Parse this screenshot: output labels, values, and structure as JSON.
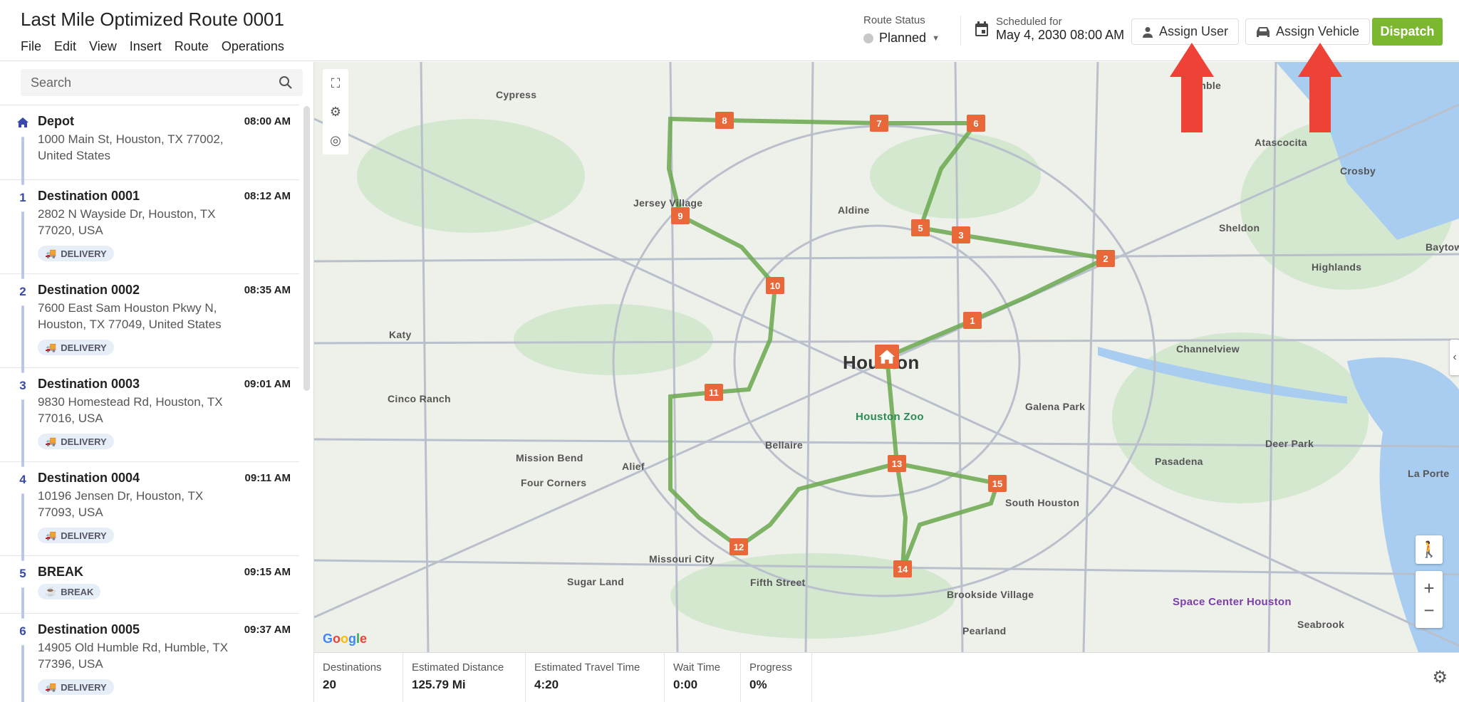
{
  "header": {
    "title": "Last Mile Optimized Route 0001",
    "menu": [
      "File",
      "Edit",
      "View",
      "Insert",
      "Route",
      "Operations"
    ],
    "route_status_label": "Route Status",
    "route_status_value": "Planned",
    "scheduled_label": "Scheduled for",
    "scheduled_value": "May 4, 2030 08:00 AM",
    "assign_user": "Assign User",
    "assign_vehicle": "Assign Vehicle",
    "dispatch": "Dispatch"
  },
  "sidebar": {
    "search_placeholder": "Search",
    "items": [
      {
        "num": "",
        "name": "Depot",
        "time": "08:00 AM",
        "address": "1000 Main St, Houston, TX 77002, United States",
        "badge": ""
      },
      {
        "num": "1",
        "name": "Destination 0001",
        "time": "08:12 AM",
        "address": "2802 N Wayside Dr, Houston, TX 77020, USA",
        "badge": "DELIVERY"
      },
      {
        "num": "2",
        "name": "Destination 0002",
        "time": "08:35 AM",
        "address": "7600 East Sam Houston Pkwy N, Houston, TX 77049, United States",
        "badge": "DELIVERY"
      },
      {
        "num": "3",
        "name": "Destination 0003",
        "time": "09:01 AM",
        "address": "9830 Homestead Rd, Houston, TX 77016, USA",
        "badge": "DELIVERY"
      },
      {
        "num": "4",
        "name": "Destination 0004",
        "time": "09:11 AM",
        "address": "10196 Jensen Dr, Houston, TX 77093, USA",
        "badge": "DELIVERY"
      },
      {
        "num": "5",
        "name": "BREAK",
        "time": "09:15 AM",
        "address": "",
        "badge": "BREAK"
      },
      {
        "num": "6",
        "name": "Destination 0005",
        "time": "09:37 AM",
        "address": "14905 Old Humble Rd, Humble, TX 77396, USA",
        "badge": "DELIVERY"
      }
    ]
  },
  "map": {
    "markers": [
      "1",
      "2",
      "3",
      "5",
      "6",
      "7",
      "8",
      "9",
      "10",
      "11",
      "12",
      "13",
      "14",
      "15"
    ],
    "labels": [
      "Houston",
      "Houston Zoo",
      "Space Center Houston",
      "Cypress",
      "Jersey Village",
      "Aldine",
      "Humble",
      "Sheldon",
      "Channelview",
      "Katy",
      "Cinco Ranch",
      "Bellaire",
      "Pasadena",
      "Sugar Land",
      "Missouri City",
      "Pearland",
      "Baytown",
      "La Porte",
      "Galena Park",
      "South Houston",
      "Crosby",
      "Highlands",
      "Mission Bend",
      "Alief",
      "Fifth Street",
      "Brookside Village",
      "Seabrook",
      "Deer Park",
      "Four Corners",
      "Atascocita"
    ],
    "route_color": "#6aa84f",
    "marker_color": "#e8683a"
  },
  "stats": [
    {
      "label": "Destinations",
      "value": "20"
    },
    {
      "label": "Estimated Distance",
      "value": "125.79 Mi"
    },
    {
      "label": "Estimated Travel Time",
      "value": "4:20"
    },
    {
      "label": "Wait Time",
      "value": "0:00"
    },
    {
      "label": "Progress",
      "value": "0%"
    }
  ]
}
